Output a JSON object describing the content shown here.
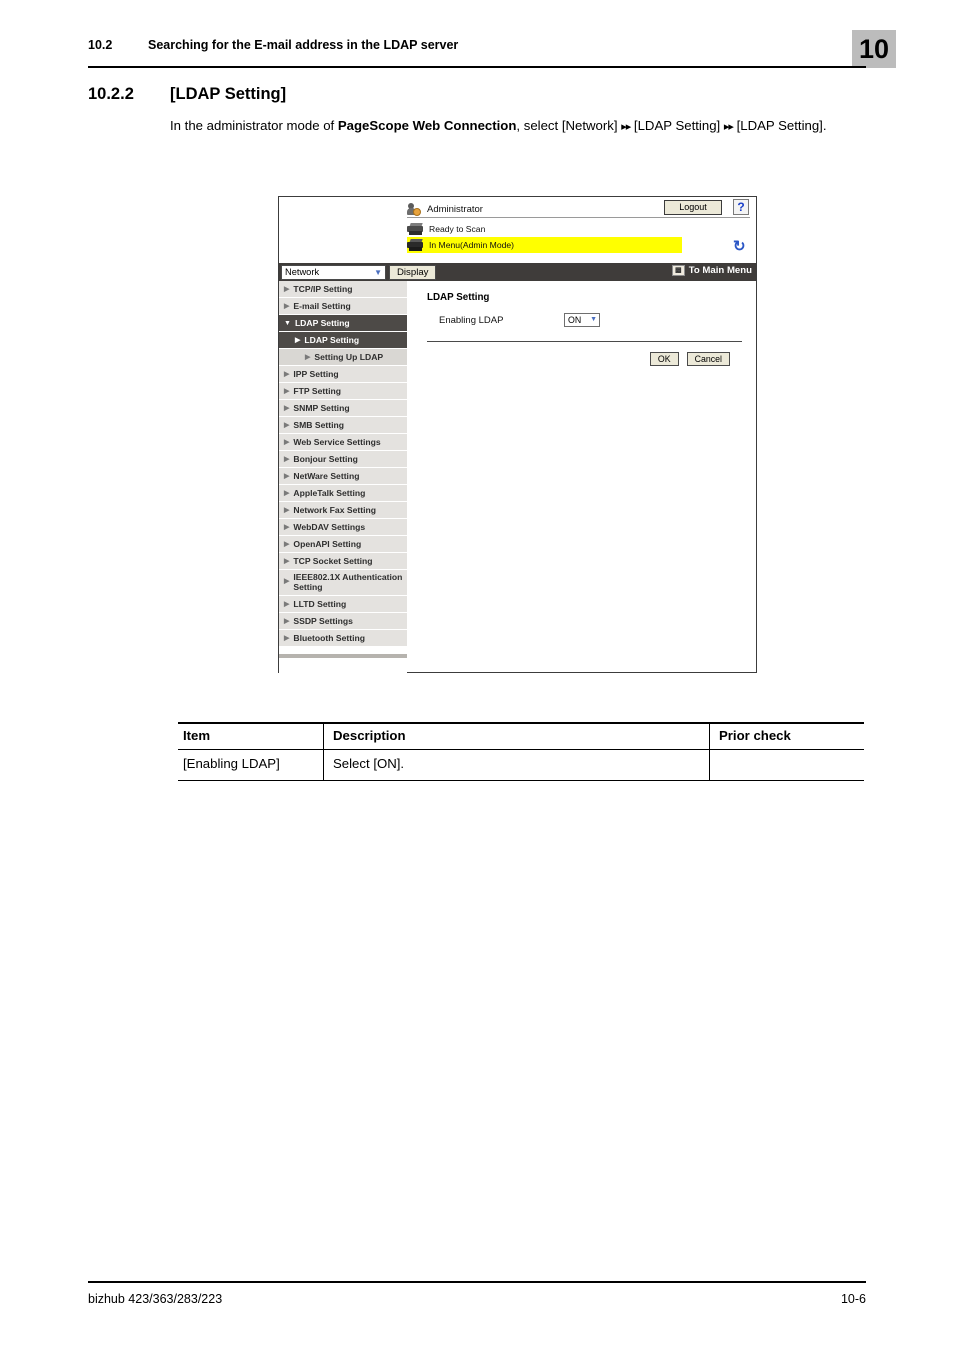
{
  "running_head": {
    "section_number": "10.2",
    "section_title": "Searching for the E-mail address in the LDAP server",
    "chapter_number": "10"
  },
  "section": {
    "number": "10.2.2",
    "title": "[LDAP Setting]",
    "intro_prefix": "In the administrator mode of ",
    "intro_bold": "PageScope Web Connection",
    "intro_mid": ", select [Network] ",
    "arrow1": "▸▸",
    "intro_path1": " [LDAP Setting] ",
    "arrow2": "▸▸",
    "intro_path2": " [LDAP Setting]."
  },
  "screenshot": {
    "status": {
      "admin_label": "Administrator",
      "logout_label": "Logout",
      "help_label": "?",
      "refresh_icon": "refresh-icon",
      "ready_label": "Ready to Scan",
      "menu_label": "In Menu(Admin Mode)",
      "highlight_color": "#ffff00"
    },
    "navbar": {
      "selected_category": "Network",
      "display_label": "Display",
      "to_main_menu_label": "To Main Menu"
    },
    "sidebar": {
      "items": [
        {
          "label": "TCP/IP Setting",
          "level": 0,
          "selected": false
        },
        {
          "label": "E-mail Setting",
          "level": 0,
          "selected": false
        },
        {
          "label": "LDAP Setting",
          "level": 0,
          "selected": true,
          "expanded": true
        },
        {
          "label": "LDAP Setting",
          "level": 1,
          "selected": true
        },
        {
          "label": "Setting Up LDAP",
          "level": 2,
          "selected": false
        },
        {
          "label": "IPP Setting",
          "level": 0,
          "selected": false
        },
        {
          "label": "FTP Setting",
          "level": 0,
          "selected": false
        },
        {
          "label": "SNMP Setting",
          "level": 0,
          "selected": false
        },
        {
          "label": "SMB Setting",
          "level": 0,
          "selected": false
        },
        {
          "label": "Web Service Settings",
          "level": 0,
          "selected": false
        },
        {
          "label": "Bonjour Setting",
          "level": 0,
          "selected": false
        },
        {
          "label": "NetWare Setting",
          "level": 0,
          "selected": false
        },
        {
          "label": "AppleTalk Setting",
          "level": 0,
          "selected": false
        },
        {
          "label": "Network Fax Setting",
          "level": 0,
          "selected": false
        },
        {
          "label": "WebDAV Settings",
          "level": 0,
          "selected": false
        },
        {
          "label": "OpenAPI Setting",
          "level": 0,
          "selected": false
        },
        {
          "label": "TCP Socket Setting",
          "level": 0,
          "selected": false
        },
        {
          "label": "IEEE802.1X Authentication Setting",
          "level": 0,
          "selected": false,
          "tall": true
        },
        {
          "label": "LLTD Setting",
          "level": 0,
          "selected": false
        },
        {
          "label": "SSDP Settings",
          "level": 0,
          "selected": false
        },
        {
          "label": "Bluetooth Setting",
          "level": 0,
          "selected": false
        }
      ]
    },
    "panel": {
      "title": "LDAP Setting",
      "field_label": "Enabling LDAP",
      "field_value": "ON",
      "ok_label": "OK",
      "cancel_label": "Cancel"
    }
  },
  "table": {
    "headers": [
      "Item",
      "Description",
      "Prior check"
    ],
    "rows": [
      {
        "item": "[Enabling LDAP]",
        "description": "Select [ON].",
        "prior_check": ""
      }
    ]
  },
  "footer": {
    "model": "bizhub 423/363/283/223",
    "page": "10-6"
  }
}
